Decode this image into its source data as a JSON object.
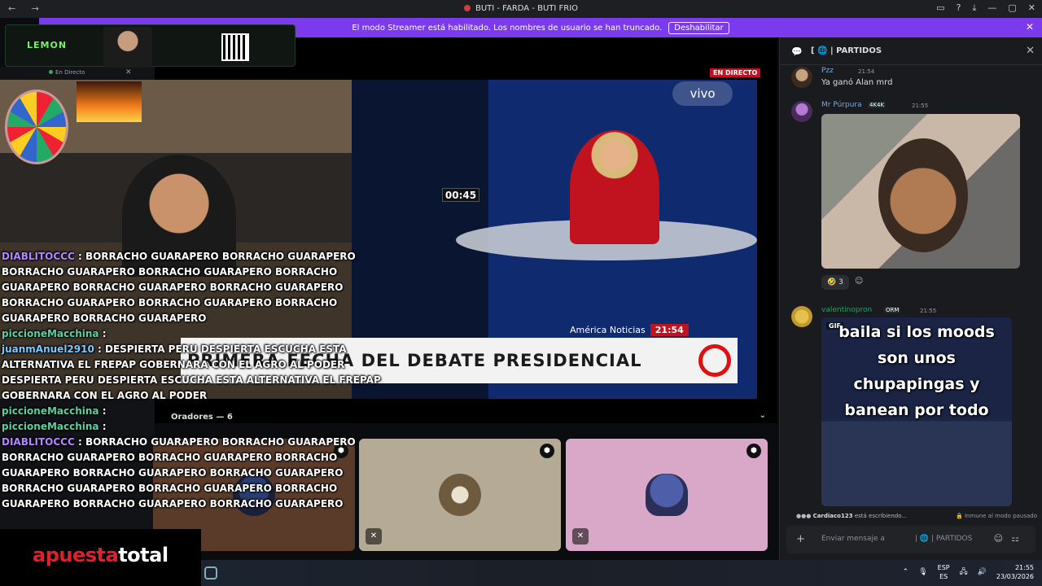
{
  "window": {
    "title": "BUTI - FARDA - BUTI FRIO",
    "nav": "← →",
    "controls": [
      "▭",
      "?",
      "⤓",
      "—",
      "▢",
      "✕"
    ]
  },
  "banner": {
    "text": "El modo Streamer está habilitado. Los nombres de usuario se han truncado.",
    "button": "Deshabilitar",
    "close": "✕"
  },
  "sponsor": {
    "logo": "LEMON"
  },
  "user_card": {
    "status": "En Directo",
    "close": "✕"
  },
  "stream": {
    "live_badge": "EN DIRECTO",
    "vivo": "vivo",
    "countdown": "00:45",
    "channel": "América Noticias",
    "clock": "21:54",
    "lower_third": "PRIMERA FECHA DEL DEBATE PRESIDENCIAL"
  },
  "speakers": {
    "header": "Oradores — 6",
    "chevron": "⌄"
  },
  "chat_overlay": [
    {
      "user": "DIABLITOCCC",
      "sep": " : ",
      "text": "BORRACHO GUARAPERO BORRACHO GUARAPERO BORRACHO GUARAPERO BORRACHO GUARAPERO BORRACHO GUARAPERO BORRACHO GUARAPERO BORRACHO GUARAPERO BORRACHO GUARAPERO BORRACHO GUARAPERO BORRACHO GUARAPERO BORRACHO GUARAPERO",
      "color": "#b388ff"
    },
    {
      "user": "piccioneMacchina",
      "sep": " :",
      "text": "",
      "color": "#5ad1a0"
    },
    {
      "user": "juanmAnuel2910",
      "sep": " : ",
      "text": "DESPIERTA PERU DESPIERTA ESCUCHA ESTA ALTERNATIVA EL FREPAP GOBERNARA CON EL AGRO AL PODER DESPIERTA PERU DESPIERTA ESCUCHA ESTA ALTERNATIVA EL FREPAP GOBERNARA CON EL AGRO AL PODER",
      "color": "#7cc8ff"
    },
    {
      "user": "piccioneMacchina",
      "sep": " :",
      "text": "",
      "color": "#5ad1a0"
    },
    {
      "user": "piccioneMacchina",
      "sep": " :",
      "text": "",
      "color": "#5ad1a0"
    },
    {
      "user": "DIABLITOCCC",
      "sep": " : ",
      "text": "BORRACHO GUARAPERO BORRACHO GUARAPERO BORRACHO GUARAPERO BORRACHO GUARAPERO BORRACHO GUARAPERO BORRACHO GUARAPERO BORRACHO GUARAPERO BORRACHO GUARAPERO BORRACHO GUARAPERO BORRACHO GUARAPERO BORRACHO GUARAPERO BORRACHO GUARAPERO",
      "color": "#b388ff"
    }
  ],
  "sponsor_bottom": {
    "part1": "apuesta",
    "part2": "total"
  },
  "panel": {
    "channel": "[ 🌐 | PARTIDOS",
    "close": "✕",
    "messages": [
      {
        "user": "Pzz",
        "time": "21:54",
        "text": "Ya ganó Alan mrd"
      },
      {
        "user": "Mr Púrpura",
        "tag": "4K4K",
        "time": "21:55",
        "reaction_count": "3"
      },
      {
        "user": "valentinopron",
        "tag": "ORM",
        "time": "21:55",
        "gif_label": "GIF",
        "gif_caption": "baila si los moods son unos chupapingas y banean por todo"
      }
    ],
    "typing_user": "Cardiaco123",
    "typing_text": "está escribiendo...",
    "immune": "Inmune al modo pausado",
    "composer_placeholder": "Enviar mensaje a",
    "composer_channel": "| 🌐 | PARTIDOS"
  },
  "taskbar": {
    "lang": "ESP",
    "lang2": "ES",
    "time": "21:55",
    "date": "23/03/2026"
  }
}
